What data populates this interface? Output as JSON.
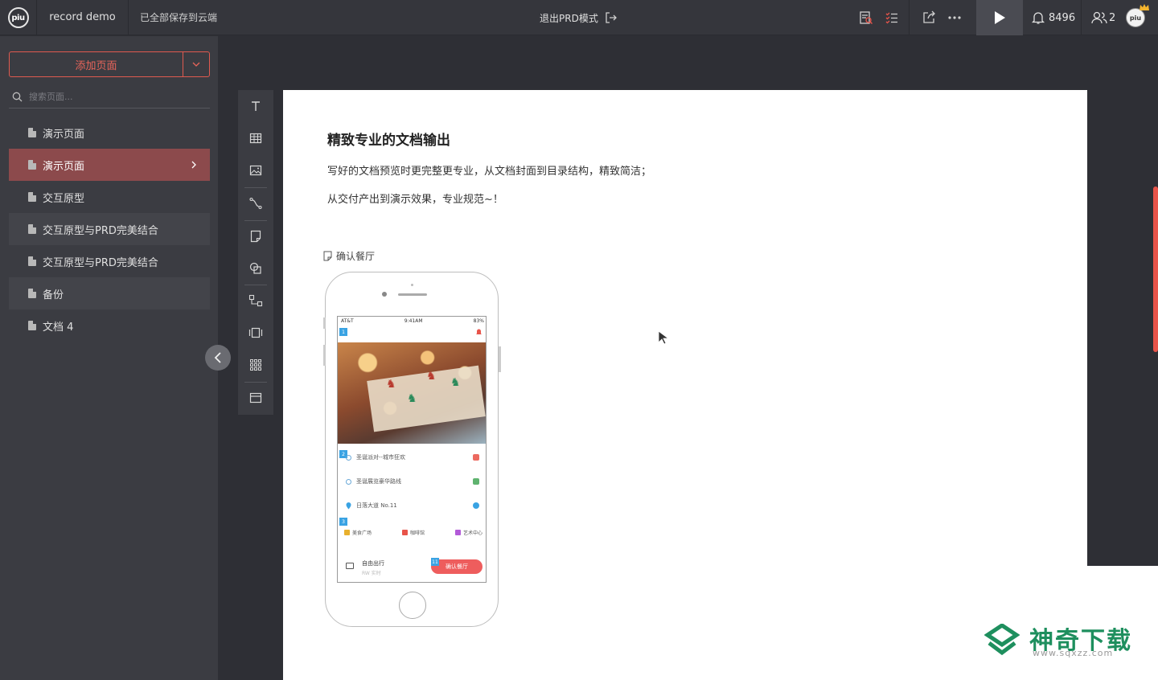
{
  "header": {
    "logo_text": "piu",
    "project_name": "record demo",
    "save_status": "已全部保存到云端",
    "exit_prd": "退出PRD模式",
    "notification_count": "8496",
    "user_count": "2",
    "avatar_text": "piu"
  },
  "sidebar": {
    "add_page_label": "添加页面",
    "search_placeholder": "搜索页面...",
    "pages": [
      {
        "label": "演示页面",
        "state": "normal"
      },
      {
        "label": "演示页面",
        "state": "active"
      },
      {
        "label": "交互原型",
        "state": "normal"
      },
      {
        "label": "交互原型与PRD完美结合",
        "state": "alt"
      },
      {
        "label": "交互原型与PRD完美结合",
        "state": "normal"
      },
      {
        "label": "备份",
        "state": "alt"
      },
      {
        "label": "文档 4",
        "state": "normal"
      }
    ]
  },
  "document": {
    "title": "精致专业的文档输出",
    "paragraph1": "写好的文档预览时更完整更专业，从文档封面到目录结构，精致简洁；",
    "paragraph2": "从交付产出到演示效果，专业规范~！",
    "page_ref": "确认餐厅"
  },
  "phone": {
    "carrier": "AT&T",
    "time": "9:41AM",
    "battery": "83%",
    "rows": [
      "圣诞派对--城市狂欢",
      "圣诞展览豪华路线",
      "日落大道 No.11"
    ],
    "categories": [
      "美食广场",
      "咖啡馆",
      "艺术中心"
    ],
    "trip_label": "自由出行",
    "trip_sub": "RW 实时",
    "confirm_button": "确认餐厅",
    "badges": [
      "1",
      "2",
      "3",
      "11"
    ]
  },
  "watermark": {
    "text": "神奇下载",
    "url": "www.sqxzz.com"
  },
  "colors": {
    "accent": "#e8655a",
    "active_page": "#8c4a4c",
    "sidebar_bg": "#3b3c42",
    "topbar_bg": "#35363c",
    "badge_blue": "#3aa3e3"
  }
}
